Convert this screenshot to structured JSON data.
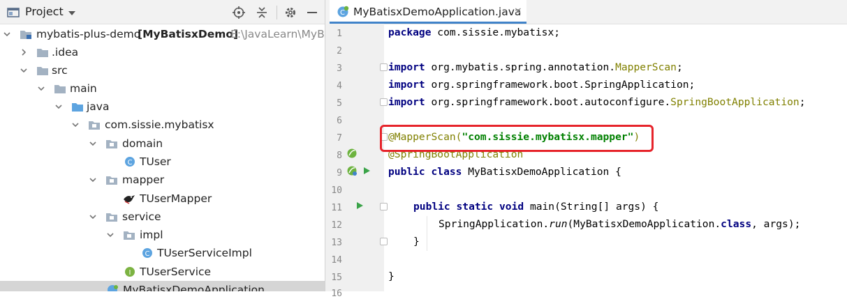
{
  "project_panel": {
    "title": "Project",
    "tree": [
      {
        "label": "mybatis-plus-demo",
        "module": "[MyBatisxDemo]",
        "path": "E:\\JavaLearn\\MyBa"
      },
      {
        "label": ".idea"
      },
      {
        "label": "src"
      },
      {
        "label": "main"
      },
      {
        "label": "java"
      },
      {
        "label": "com.sissie.mybatisx"
      },
      {
        "label": "domain"
      },
      {
        "label": "TUser"
      },
      {
        "label": "mapper"
      },
      {
        "label": "TUserMapper"
      },
      {
        "label": "service"
      },
      {
        "label": "impl"
      },
      {
        "label": "TUserServiceImpl"
      },
      {
        "label": "TUserService"
      },
      {
        "label": "MyBatisxDemoApplication"
      }
    ]
  },
  "editor": {
    "tab": {
      "label": "MyBatisxDemoApplication.java",
      "close": "×"
    },
    "line_numbers": [
      "1",
      "2",
      "3",
      "4",
      "5",
      "6",
      "7",
      "8",
      "9",
      "10",
      "11",
      "12",
      "13",
      "14",
      "15",
      "16"
    ],
    "code": {
      "l1_kw": "package",
      "l1_rest": " com.sissie.mybatisx;",
      "l3_kw": "import",
      "l3_pkg": " org.mybatis.spring.annotation.",
      "l3_cls": "MapperScan",
      "l3_end": ";",
      "l4_kw": "import",
      "l4_rest": " org.springframework.boot.SpringApplication;",
      "l5_kw": "import",
      "l5_pkg": " org.springframework.boot.autoconfigure.",
      "l5_cls": "SpringBootApplication",
      "l5_end": ";",
      "l7_ann": "@MapperScan(",
      "l7_str": "\"com.sissie.mybatisx.mapper\"",
      "l7_end": ")",
      "l8_ann": "@SpringBootApplication",
      "l9_kw": "public class",
      "l9_rest": " MyBatisxDemoApplication {",
      "l11_kw": "public static void",
      "l11_rest": " main(String[] args) {",
      "l12_a": "SpringApplication.",
      "l12_run": "run",
      "l12_b": "(MyBatisxDemoApplication.",
      "l12_kw": "class",
      "l12_c": ", args);",
      "l13": "}",
      "l15": "}"
    }
  },
  "colors": {
    "accent": "#4083c9",
    "highlight": "#e6242b",
    "annotation": "#808000",
    "string": "#008000",
    "keyword": "#000080"
  }
}
